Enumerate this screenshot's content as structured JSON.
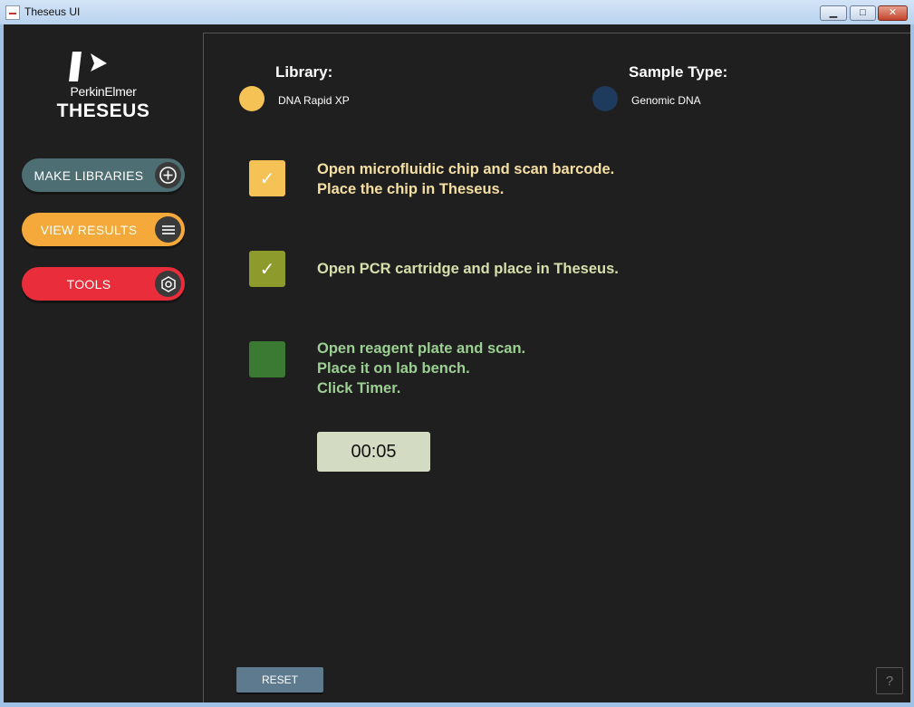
{
  "window": {
    "title": "Theseus UI",
    "min_glyph": "▁",
    "max_glyph": "□",
    "close_glyph": "✕"
  },
  "sidebar": {
    "brand": "PerkinElmer",
    "product": "THESEUS",
    "nav": [
      {
        "label": "MAKE LIBRARIES",
        "icon": "plus-circle-icon",
        "color": "#4d6e73"
      },
      {
        "label": "VIEW RESULTS",
        "icon": "menu-icon",
        "color": "#f4a93a"
      },
      {
        "label": "TOOLS",
        "icon": "hexagon-nut-icon",
        "color": "#ea2d3a"
      }
    ]
  },
  "main": {
    "library": {
      "label": "Library:",
      "value": "DNA Rapid XP",
      "color": "#f5c255"
    },
    "sample_type": {
      "label": "Sample Type:",
      "value": "Genomic DNA",
      "color": "#1e3a5c"
    },
    "steps": [
      {
        "lines": [
          "Open microfluidic chip and scan barcode.",
          "Place the chip in Theseus."
        ],
        "checked": true,
        "check": "✓",
        "box_color": "#f5c255",
        "text_color": "#f6dfa3"
      },
      {
        "lines": [
          "Open PCR cartridge and place in Theseus."
        ],
        "checked": true,
        "check": "✓",
        "box_color": "#8c9b2c",
        "text_color": "#d7dfad"
      },
      {
        "lines": [
          "Open reagent plate and scan.",
          "Place it on lab bench.",
          "Click Timer."
        ],
        "checked": false,
        "check": "",
        "box_color": "#3a7a32",
        "text_color": "#9ccf93"
      }
    ],
    "timer": "00:05",
    "reset_label": "RESET",
    "help_label": "?"
  }
}
